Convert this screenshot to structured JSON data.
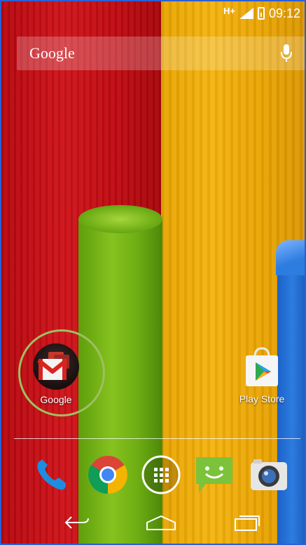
{
  "status_bar": {
    "network": "H+",
    "time": "09:12"
  },
  "search_bar": {
    "label": "Google"
  },
  "home_apps": [
    {
      "label": "Google",
      "icon": "google-folder-icon",
      "highlighted": true
    },
    {
      "label": "Play Store",
      "icon": "play-store-icon"
    }
  ],
  "dock": [
    {
      "name": "phone-icon"
    },
    {
      "name": "chrome-icon"
    },
    {
      "name": "app-drawer-icon"
    },
    {
      "name": "messaging-icon"
    },
    {
      "name": "camera-icon"
    }
  ],
  "nav": [
    "back-icon",
    "home-icon",
    "recents-icon"
  ],
  "colors": {
    "highlight_ring": "#9fbf62",
    "wallpaper_red": "#c10b12",
    "wallpaper_yellow": "#f3b20c",
    "wallpaper_green": "#86c21f",
    "wallpaper_blue": "#2d7ce0"
  }
}
